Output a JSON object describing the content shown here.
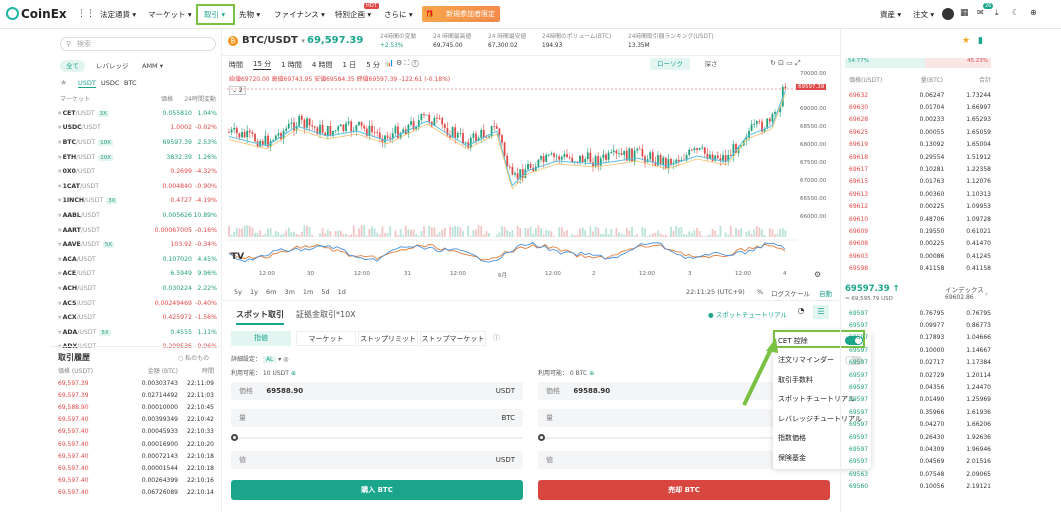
{
  "nav": {
    "logo": "CoinEx",
    "items": [
      "法定通貨",
      "マーケット",
      "取引",
      "先物",
      "ファイナンス",
      "特別企画",
      "さらに"
    ],
    "hot": "HOT",
    "promo": "新規参加者限定",
    "right": [
      "資産",
      "注文"
    ],
    "badge": "26"
  },
  "left": {
    "search_placeholder": "検索",
    "tabs": [
      "全て",
      "レバレッジ",
      "AMM"
    ],
    "quote_tabs": [
      "USDT",
      "USDC",
      "BTC"
    ],
    "headers": [
      "マーケット",
      "価格",
      "24時間変動"
    ],
    "markets": [
      {
        "base": "CET",
        "quote": "/USDT",
        "tag": "3X",
        "price": "0.055810",
        "change": "1.04%",
        "dir": "up"
      },
      {
        "base": "USDC",
        "quote": "/USDT",
        "tag": "",
        "price": "1.0002",
        "change": "-0.02%",
        "dir": "dn"
      },
      {
        "base": "BTC",
        "quote": "/USDT",
        "tag": "10X",
        "price": "69597.39",
        "change": "2.53%",
        "dir": "up"
      },
      {
        "base": "ETH",
        "quote": "/USDT",
        "tag": "10X",
        "price": "3832.39",
        "change": "1.26%",
        "dir": "up"
      },
      {
        "base": "0X0",
        "quote": "/USDT",
        "tag": "",
        "price": "0.2699",
        "change": "-4.32%",
        "dir": "dn"
      },
      {
        "base": "1CAT",
        "quote": "/USDT",
        "tag": "",
        "price": "0.004840",
        "change": "-0.90%",
        "dir": "dn"
      },
      {
        "base": "1INCH",
        "quote": "/USDT",
        "tag": "3X",
        "price": "0.4727",
        "change": "-4.19%",
        "dir": "dn"
      },
      {
        "base": "AABL",
        "quote": "/USDT",
        "tag": "",
        "price": "0.005626",
        "change": "10.89%",
        "dir": "up"
      },
      {
        "base": "AART",
        "quote": "/USDT",
        "tag": "",
        "price": "0.00067005",
        "change": "-0.16%",
        "dir": "dn"
      },
      {
        "base": "AAVE",
        "quote": "/USDT",
        "tag": "5X",
        "price": "103.92",
        "change": "-0.34%",
        "dir": "dn"
      },
      {
        "base": "ACA",
        "quote": "/USDT",
        "tag": "",
        "price": "0.107020",
        "change": "4.45%",
        "dir": "up"
      },
      {
        "base": "ACE",
        "quote": "/USDT",
        "tag": "",
        "price": "6.5949",
        "change": "9.96%",
        "dir": "up"
      },
      {
        "base": "ACH",
        "quote": "/USDT",
        "tag": "",
        "price": "0.030224",
        "change": "2.22%",
        "dir": "up"
      },
      {
        "base": "ACS",
        "quote": "/USDT",
        "tag": "",
        "price": "0.00249469",
        "change": "-0.40%",
        "dir": "dn"
      },
      {
        "base": "ACX",
        "quote": "/USDT",
        "tag": "",
        "price": "0.425972",
        "change": "-1.56%",
        "dir": "dn"
      },
      {
        "base": "ADA",
        "quote": "/USDT",
        "tag": "5X",
        "price": "0.4555",
        "change": "1.11%",
        "dir": "up"
      },
      {
        "base": "ADX",
        "quote": "/USDT",
        "tag": "",
        "price": "0.209536",
        "change": "-0.06%",
        "dir": "dn"
      }
    ],
    "history_title": "取引履歴",
    "history_filter": "私のもの",
    "history_headers": [
      "価格 (USDT)",
      "金額 (BTC)",
      "時間"
    ],
    "history": [
      [
        "69,597.39",
        "0.00303743",
        "22:11:09"
      ],
      [
        "69,597.39",
        "0.02714492",
        "22:11:03"
      ],
      [
        "69,588.90",
        "0.00010000",
        "22:10:45"
      ],
      [
        "69,597.40",
        "0.00399349",
        "22:10:42"
      ],
      [
        "69,597.40",
        "0.00045933",
        "22:10:33"
      ],
      [
        "69,597.40",
        "0.00016900",
        "22:10:20"
      ],
      [
        "69,597.40",
        "0.00072143",
        "22:10:18"
      ],
      [
        "69,597.40",
        "0.00001544",
        "22:10:18"
      ],
      [
        "69,597.40",
        "0.00264399",
        "22:10:16"
      ],
      [
        "69,597.40",
        "0.06726089",
        "22:10:14"
      ]
    ]
  },
  "ticker": {
    "pair": "BTC/USDT",
    "price": "69,597.39",
    "stats": [
      [
        "24時間の変動",
        "+2.53%"
      ],
      [
        "24 時間最高値",
        "69,745.00"
      ],
      [
        "24 時間最安値",
        "67,300.02"
      ],
      [
        "24時間のボリューム(BTC)",
        "194.93"
      ],
      [
        "24時間取引額ランキング(USDT)",
        "13.35M"
      ]
    ]
  },
  "chart": {
    "toolbar": [
      "時間",
      "15 分",
      "1 時間",
      "4 時間",
      "1 日",
      "5 分"
    ],
    "mode_tabs": [
      "ローソク",
      "深さ"
    ],
    "ohlc": "始値69720.00 高値69743.95 安値69584.35 終値69597.39 -122.61 (-0.18%)",
    "y_ticks": [
      "70000.00",
      "69000.00",
      "68500.00",
      "68000.00",
      "67500.00",
      "67000.00",
      "66500.00",
      "66000.00"
    ],
    "last_price": "69597.39",
    "x_ticks": [
      "12:00",
      "30",
      "12:00",
      "31",
      "12:00",
      "6月",
      "12:00",
      "2",
      "12:00",
      "3",
      "12:00",
      "4"
    ],
    "ranges": [
      "5y",
      "1y",
      "6m",
      "3m",
      "1m",
      "5d",
      "1d"
    ],
    "time": "22:11:25 (UTC+9)",
    "scale": [
      "%",
      "ログスケール",
      "自動"
    ]
  },
  "order": {
    "tabs": [
      "スポット取引",
      "証拠金取引*10X"
    ],
    "types": [
      "指値",
      "マーケット",
      "ストップリミット",
      "ストップマーケット"
    ],
    "tutorial": "スポットチュートリアル",
    "detail": "詳細設定：",
    "detail_val": "AL",
    "avail_buy": "利用可能： 10 USDT",
    "avail_sell": "利用可能： 0 BTC",
    "price_label": "価格",
    "price_val": "69588.90",
    "amount_label": "量",
    "total_label": "値",
    "usdt": "USDT",
    "btc": "BTC",
    "buy": "購入 BTC",
    "sell": "売却 BTC"
  },
  "menu": {
    "items": [
      "CET 控除",
      "注文リマインダー",
      "取引手数料",
      "スポットチュートリアル",
      "レバレッジチュートリアル",
      "指数価格",
      "保険基金"
    ]
  },
  "orderbook": {
    "buy_pct": "54.77%",
    "sell_pct": "45.23%",
    "headers": [
      "価格(USDT)",
      "量(BTC)",
      "合計"
    ],
    "asks": [
      [
        "69632",
        "0.06247",
        "1.73244"
      ],
      [
        "69630",
        "0.01704",
        "1.66997"
      ],
      [
        "69628",
        "0.00233",
        "1.65293"
      ],
      [
        "69625",
        "0.00055",
        "1.65059"
      ],
      [
        "69619",
        "0.13092",
        "1.65004"
      ],
      [
        "69618",
        "0.29554",
        "1.51912"
      ],
      [
        "69617",
        "0.10281",
        "1.22358"
      ],
      [
        "69615",
        "0.01763",
        "1.12076"
      ],
      [
        "69613",
        "0.00360",
        "1.10313"
      ],
      [
        "69612",
        "0.00225",
        "1.09953"
      ],
      [
        "69610",
        "0.48706",
        "1.09728"
      ],
      [
        "69609",
        "0.19550",
        "0.61021"
      ],
      [
        "69608",
        "0.00225",
        "0.41470"
      ],
      [
        "69603",
        "0.00086",
        "0.41245"
      ],
      [
        "69598",
        "0.41158",
        "0.41158"
      ]
    ],
    "mid_price": "69597.39",
    "mid_sub": "≈ 69,595.79 USD",
    "index_label": "インデックス",
    "index_val": "69602.86",
    "bids": [
      [
        "69597",
        "0.76795",
        "0.76795"
      ],
      [
        "69597",
        "0.09977",
        "0.86773"
      ],
      [
        "69597",
        "0.17893",
        "1.04666"
      ],
      [
        "69597",
        "0.10000",
        "1.14667"
      ],
      [
        "69597",
        "0.02717",
        "1.17384"
      ],
      [
        "69597",
        "0.02729",
        "1.20114"
      ],
      [
        "69597",
        "0.04356",
        "1.24470"
      ],
      [
        "69597",
        "0.01490",
        "1.25969"
      ],
      [
        "69597",
        "0.35966",
        "1.61936"
      ],
      [
        "69597",
        "0.04270",
        "1.66206"
      ],
      [
        "69597",
        "0.26430",
        "1.92636"
      ],
      [
        "69597",
        "0.04309",
        "1.96946"
      ],
      [
        "69597",
        "0.04569",
        "2.01516"
      ],
      [
        "69563",
        "0.07548",
        "2.09065"
      ],
      [
        "69560",
        "0.10056",
        "2.19121"
      ]
    ]
  }
}
